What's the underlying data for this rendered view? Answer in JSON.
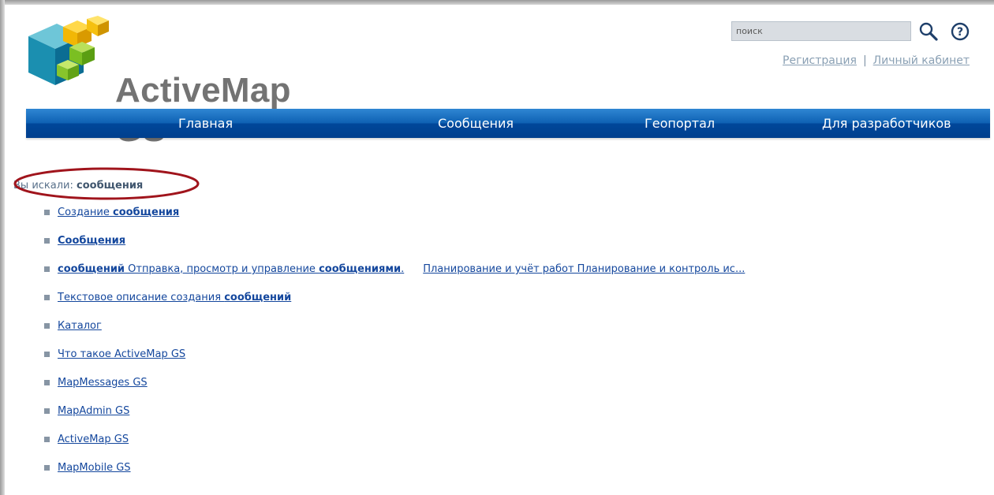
{
  "logo": {
    "text": "ActiveMap GS"
  },
  "search": {
    "placeholder": "поиск"
  },
  "header_links": {
    "register": "Регистрация",
    "separator": "|",
    "cabinet": "Личный кабинет"
  },
  "nav": {
    "items": [
      {
        "label": "Главная"
      },
      {
        "label": "Сообщения"
      },
      {
        "label": "Геопортал"
      },
      {
        "label": "Для разработчиков"
      }
    ]
  },
  "query": {
    "prefix": "Вы искали: ",
    "term": "сообщения"
  },
  "results": [
    {
      "parts": [
        {
          "text": "Создание "
        },
        {
          "text": "сообщения",
          "bold": true
        }
      ]
    },
    {
      "parts": [
        {
          "text": "Сообщения",
          "bold": true
        }
      ]
    },
    {
      "parts": [
        {
          "text": "сообщений",
          "bold": true
        },
        {
          "text": " Отправка, просмотр и управление "
        },
        {
          "text": "сообщениями",
          "bold": true
        },
        {
          "text": "."
        },
        {
          "gap": true
        },
        {
          "text": "Планирование и учёт работ  Планирование и контроль ис..."
        }
      ]
    },
    {
      "parts": [
        {
          "text": "Текстовое описание создания "
        },
        {
          "text": "сообщений",
          "bold": true
        }
      ]
    },
    {
      "parts": [
        {
          "text": "Каталог"
        }
      ]
    },
    {
      "parts": [
        {
          "text": "Что такое ActiveMap GS"
        }
      ]
    },
    {
      "parts": [
        {
          "text": "MapMessages GS"
        }
      ]
    },
    {
      "parts": [
        {
          "text": "MapAdmin GS"
        }
      ]
    },
    {
      "parts": [
        {
          "text": "ActiveMap GS"
        }
      ]
    },
    {
      "parts": [
        {
          "text": "MapMobile GS"
        }
      ]
    }
  ],
  "colors": {
    "nav_top": "#2f86d3",
    "nav_bottom": "#003f8d",
    "link": "#14479d",
    "highlight_ellipse": "#a0141c"
  },
  "icons": [
    "magnifier-icon",
    "help-icon",
    "logo-cubes-icon",
    "bullet-square-icon"
  ]
}
